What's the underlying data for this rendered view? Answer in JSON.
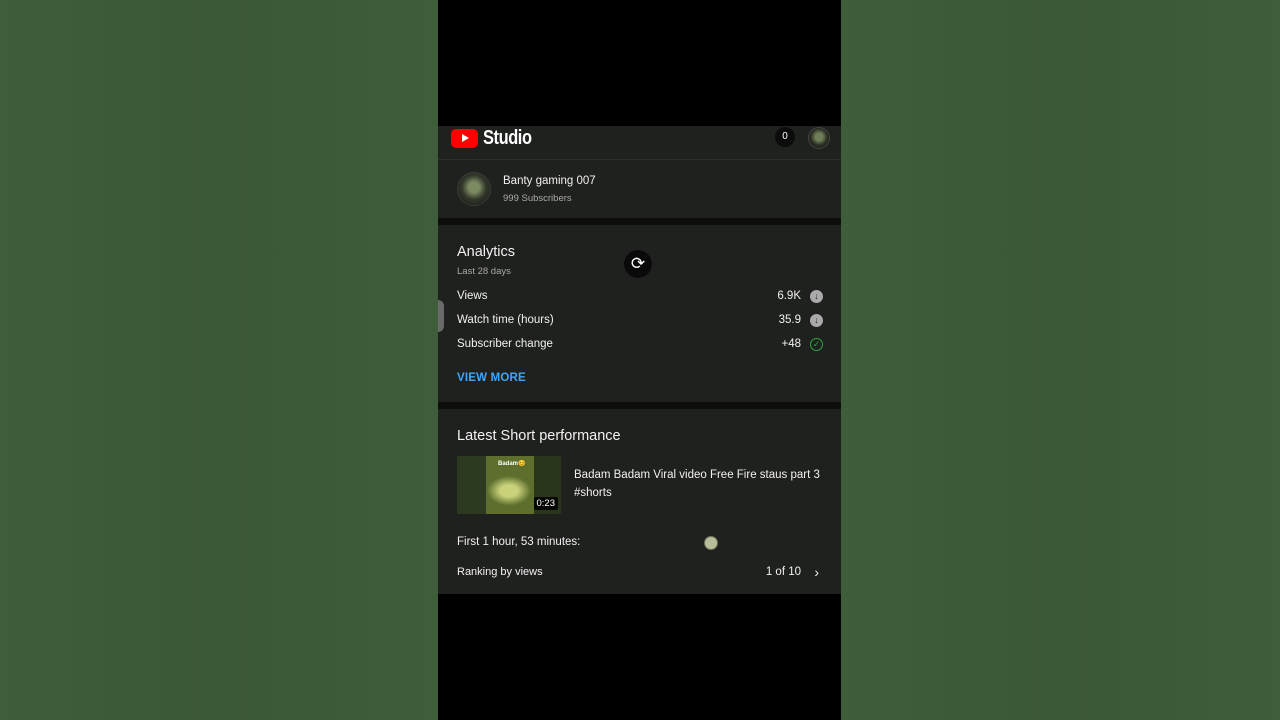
{
  "app": {
    "title": "Studio"
  },
  "header": {
    "notification_count": "0"
  },
  "channel": {
    "name": "Banty gaming 007",
    "subscribers": "999 Subscribers"
  },
  "analytics": {
    "title": "Analytics",
    "period": "Last 28 days",
    "metrics": [
      {
        "label": "Views",
        "value": "6.9K",
        "status_icon": "arrow-down-icon"
      },
      {
        "label": "Watch time (hours)",
        "value": "35.9",
        "status_icon": "arrow-down-icon"
      },
      {
        "label": "Subscriber change",
        "value": "+48",
        "status_icon": "check-icon"
      }
    ],
    "view_more": "VIEW MORE"
  },
  "latest_short": {
    "title": "Latest Short performance",
    "thumbnail_text": "Badam😊",
    "duration": "0:23",
    "video_title": "Badam Badam Viral video Free Fire staus part 3 #shorts",
    "first_period": "First 1 hour, 53 minutes:",
    "ranking_label": "Ranking by views",
    "ranking_value": "1 of 10"
  },
  "colors": {
    "background": "#3c5a38",
    "card": "#1f211e",
    "accent_link": "#3ea6ff",
    "youtube_red": "#ff0000",
    "check_green": "#2ba640"
  }
}
